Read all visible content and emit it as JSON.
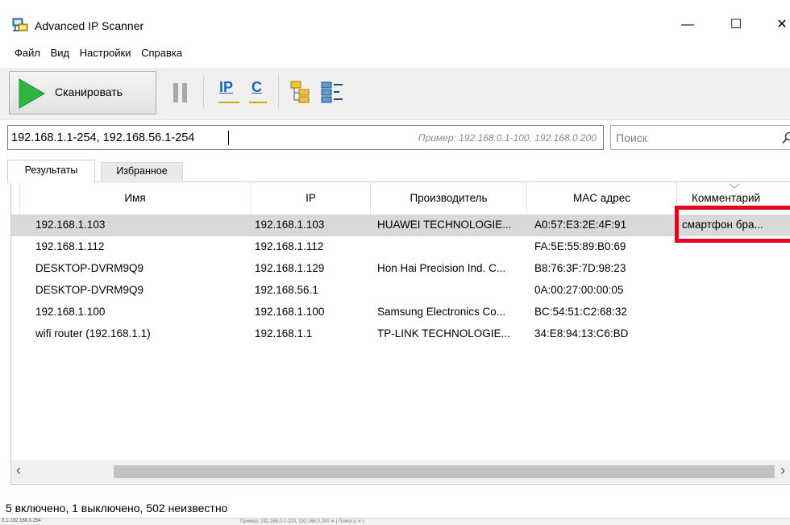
{
  "window": {
    "title": "Advanced IP Scanner",
    "minimize_glyph": "—",
    "maximize_glyph": "☐",
    "close_glyph": "✕"
  },
  "menu": {
    "items": [
      "Файл",
      "Вид",
      "Настройки",
      "Справка"
    ]
  },
  "toolbar": {
    "scan_label": "Сканировать",
    "ip_label": "IP",
    "c_label": "C"
  },
  "address": {
    "value": "192.168.1.1-254, 192.168.56.1-254",
    "hint": "Пример: 192.168.0.1-100, 192.168.0.200"
  },
  "search": {
    "placeholder": "Поиск"
  },
  "tabs": [
    "Результаты",
    "Избранное"
  ],
  "table": {
    "columns": [
      "Имя",
      "IP",
      "Производитель",
      "MAC адрес",
      "Комментарий"
    ],
    "rows": [
      {
        "name": "192.168.1.103",
        "ip": "192.168.1.103",
        "vendor": "HUAWEI TECHNOLOGIE...",
        "mac": "A0:57:E3:2E:4F:91",
        "comment": "смартфон бра..."
      },
      {
        "name": "192.168.1.112",
        "ip": "192.168.1.112",
        "vendor": "",
        "mac": "FA:5E:55:89:B0:69",
        "comment": ""
      },
      {
        "name": "DESKTOP-DVRM9Q9",
        "ip": "192.168.1.129",
        "vendor": "Hon Hai Precision Ind. C...",
        "mac": "B8:76:3F:7D:98:23",
        "comment": ""
      },
      {
        "name": "DESKTOP-DVRM9Q9",
        "ip": "192.168.56.1",
        "vendor": "",
        "mac": "0A:00:27:00:00:05",
        "comment": ""
      },
      {
        "name": "192.168.1.100",
        "ip": "192.168.1.100",
        "vendor": "Samsung Electronics Co...",
        "mac": "BC:54:51:C2:68:32",
        "comment": ""
      },
      {
        "name": "wifi router (192.168.1.1)",
        "ip": "192.168.1.1",
        "vendor": "TP-LINK TECHNOLOGIE...",
        "mac": "34:E8:94:13:C6:BD",
        "comment": ""
      }
    ]
  },
  "scrollbar": {
    "left_arrow": "‹",
    "right_arrow": "›"
  },
  "status": {
    "text": "5 включено, 1 выключено, 502 неизвестно"
  },
  "strip": {
    "left": "0.1-192.168.0.254",
    "middle": "Пример: 192.168.0.1-100, 192.168.0.200  ✕  | Поиск          ρ ✕ |"
  },
  "colors": {
    "highlight": "#e8001c",
    "selected_row": "#d9d9d9",
    "scan_green": "#2fb544",
    "icon_blue": "#1e62c8"
  },
  "icons": {
    "app": "network-computer-icon",
    "scan": "play-icon",
    "pause": "pause-icon",
    "ip": "ip-scan-icon",
    "c": "c-subnet-icon",
    "expand": "expand-tree-icon",
    "collapse": "collapse-tree-icon",
    "search": "search-icon"
  }
}
